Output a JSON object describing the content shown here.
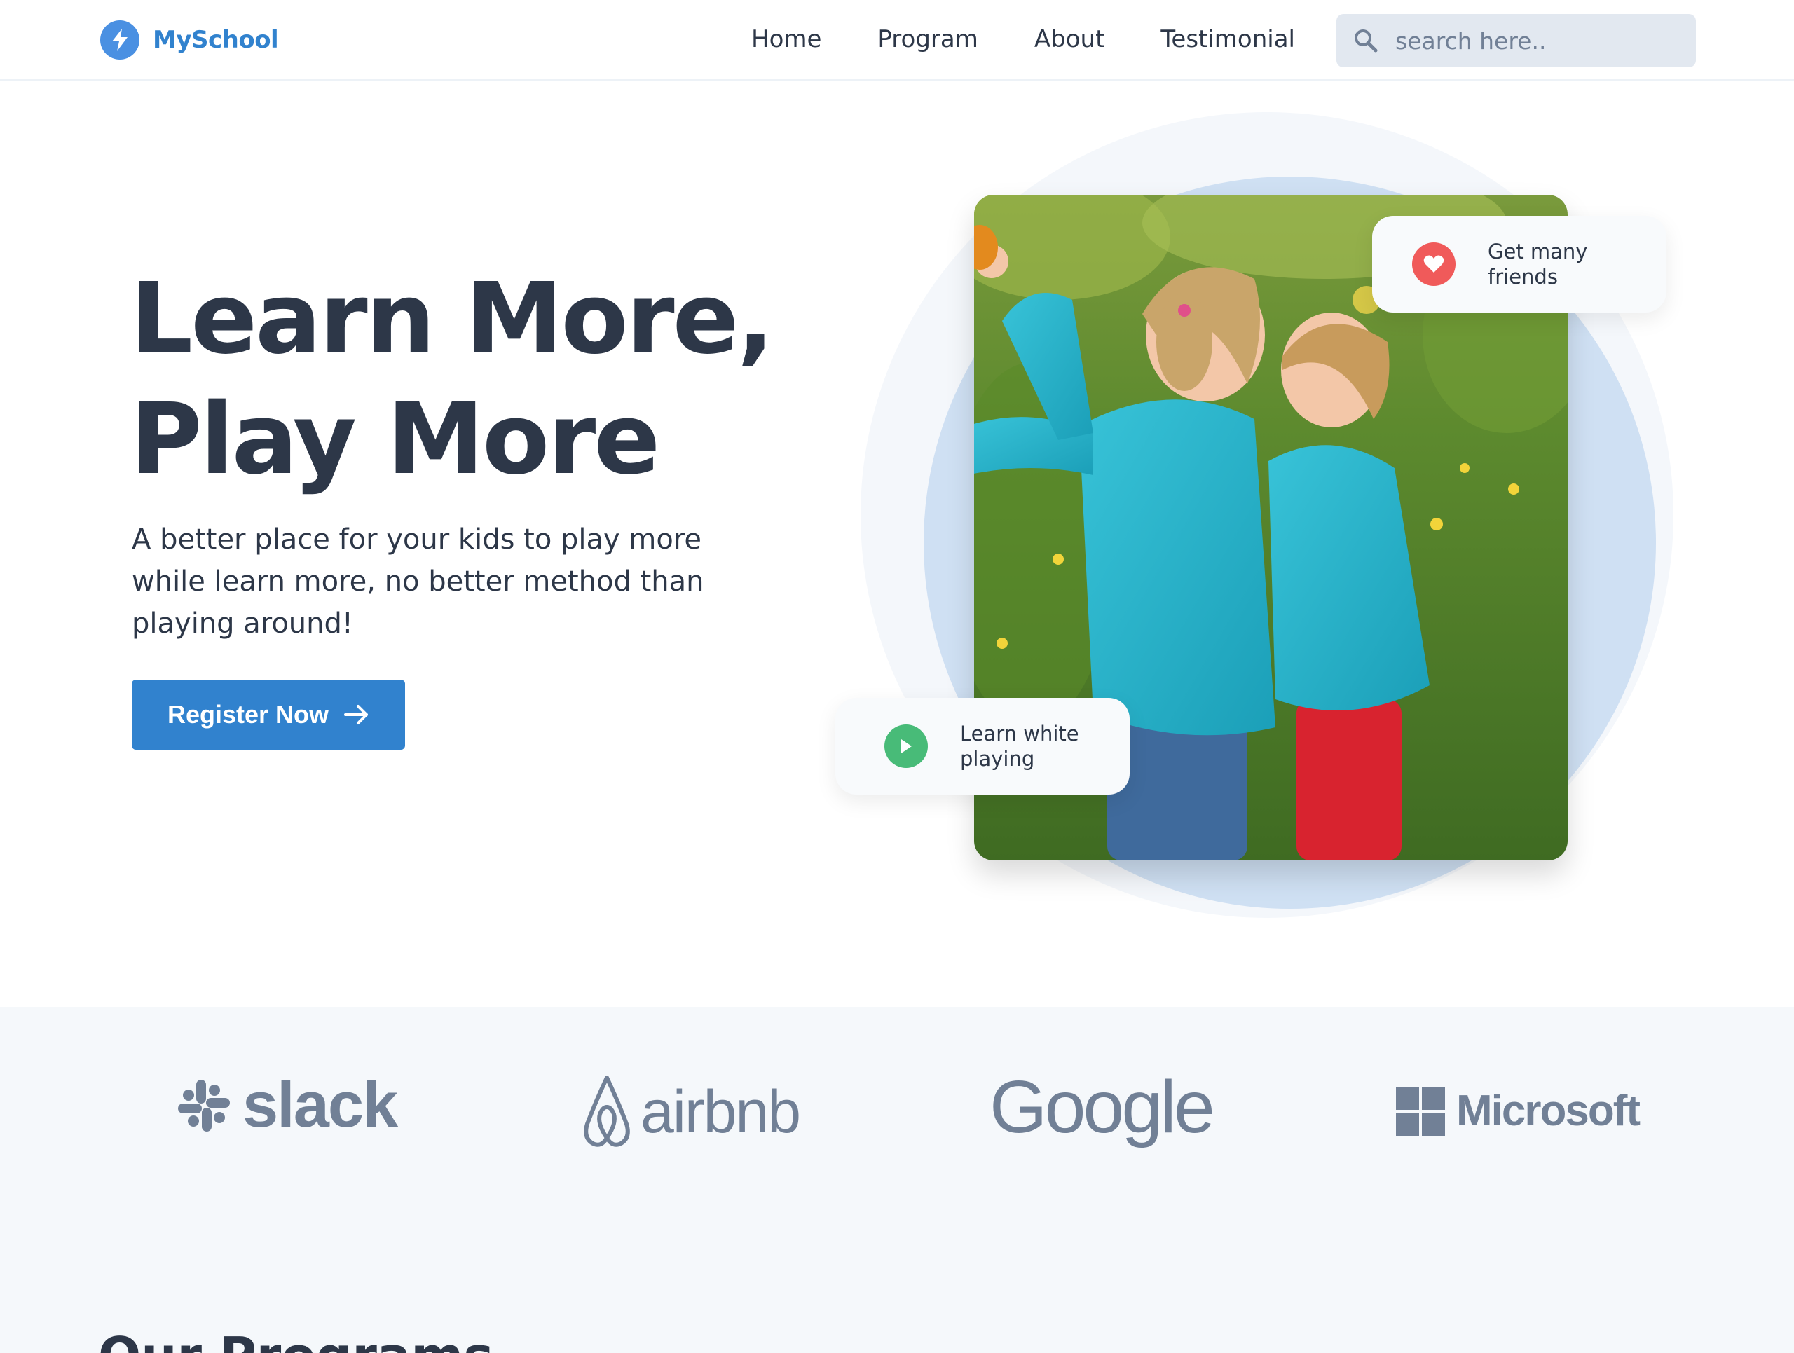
{
  "header": {
    "logo_text": "MySchool",
    "nav": [
      "Home",
      "Program",
      "About",
      "Testimonial"
    ],
    "search_placeholder": "search here.."
  },
  "hero": {
    "title_line1": "Learn More,",
    "title_line2": "Play More",
    "subtitle": "A better place for your kids to play more while learn more, no better method than playing around!",
    "register_label": "Register Now",
    "card_friends": "Get many friends",
    "card_play": "Learn white playing"
  },
  "partners": {
    "slack": "slack",
    "airbnb": "airbnb",
    "google": "Google",
    "microsoft": "Microsoft"
  },
  "programs": {
    "title": "Our Programs"
  },
  "colors": {
    "accent": "#3182ce",
    "text": "#2d3748",
    "muted": "#718096",
    "heart": "#f05a5a",
    "play": "#48bb78"
  }
}
